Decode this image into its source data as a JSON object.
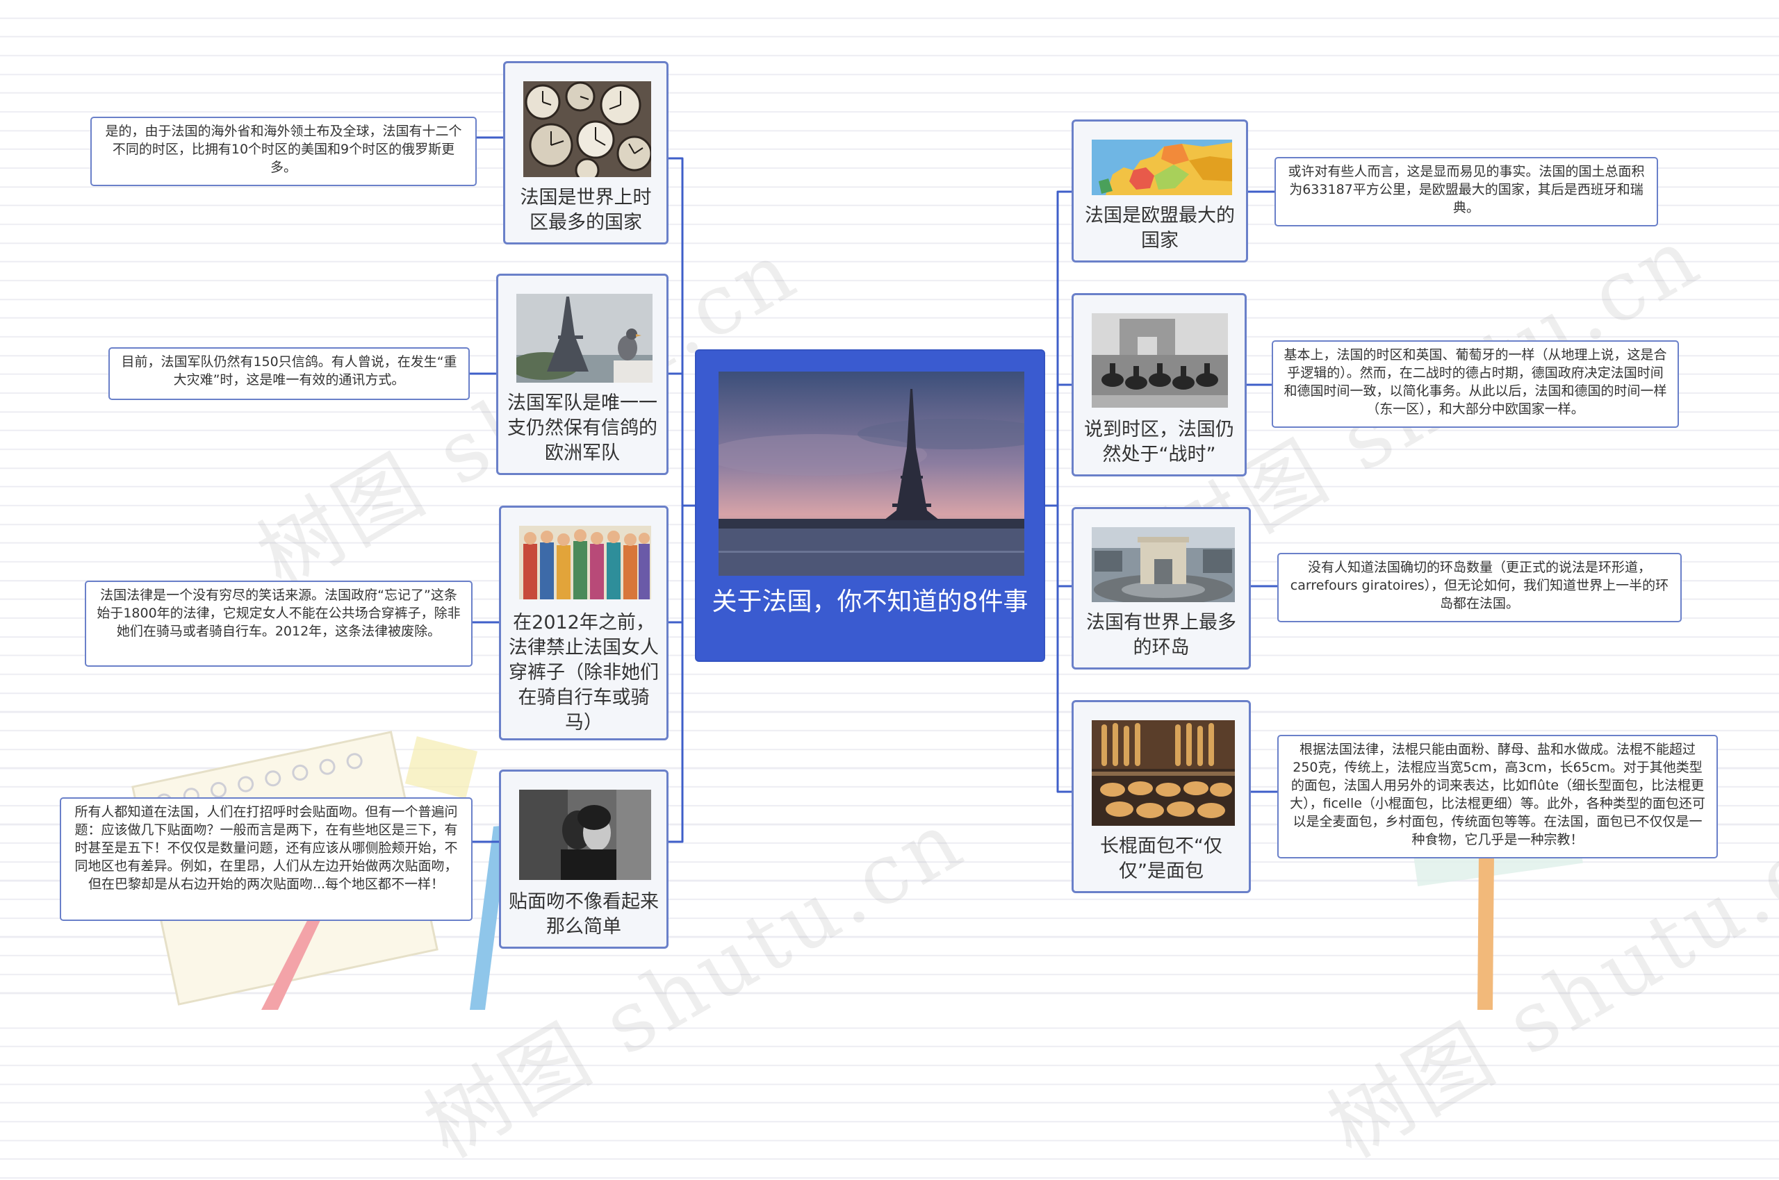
{
  "center": {
    "title": "关于法国，你不知道的8件事"
  },
  "watermark": "树图 shutu.cn",
  "colors": {
    "accent": "#3a5bd0",
    "line": "#3f5fc9",
    "border": "#6a80c9"
  },
  "topics": {
    "timezones": {
      "label": "法国是世界上时区最多的国家",
      "note": "是的，由于法国的海外省和海外领土布及全球，法国有十二个不同的时区，比拥有10个时区的美国和9个时区的俄罗斯更多。"
    },
    "pigeons": {
      "label": "法国军队是唯一一支仍然保有信鸽的欧洲军队",
      "note": "目前，法国军队仍然有150只信鸽。有人曾说，在发生“重大灾难”时，这是唯一有效的通讯方式。"
    },
    "trousers": {
      "label": "在2012年之前，法律禁止法国女人穿裤子（除非她们在骑自行车或骑马）",
      "note": "法国法律是一个没有穷尽的笑话来源。法国政府“忘记了”这条始于1800年的法律，它规定女人不能在公共场合穿裤子，除非她们在骑马或者骑自行车。2012年，这条法律被废除。"
    },
    "kiss": {
      "label": "贴面吻不像看起来那么简单",
      "note": "所有人都知道在法国，人们在打招呼时会贴面吻。但有一个普遍问题：应该做几下贴面吻？一般而言是两下，在有些地区是三下，有时甚至是五下！不仅仅是数量问题，还有应该从哪侧脸颊开始，不同地区也有差异。例如，在里昂，人们从左边开始做两次贴面吻，但在巴黎却是从右边开始的两次贴面吻...每个地区都不一样！"
    },
    "largest": {
      "label": "法国是欧盟最大的国家",
      "note": "或许对有些人而言，这是显而易见的事实。法国的国土总面积为633187平方公里，是欧盟最大的国家，其后是西班牙和瑞典。"
    },
    "war": {
      "label": "说到时区，法国仍然处于“战时”",
      "note": "基本上，法国的时区和英国、葡萄牙的一样（从地理上说，这是合乎逻辑的）。然而，在二战时的德占时期，德国政府决定法国时间和德国时间一致，以简化事务。从此以后，法国和德国的时间一样（东一区），和大部分中欧国家一样。"
    },
    "roundabouts": {
      "label": "法国有世界上最多的环岛",
      "note": "没有人知道法国确切的环岛数量（更正式的说法是环形道，carrefours giratoires），但无论如何，我们知道世界上一半的环岛都在法国。"
    },
    "baguette": {
      "label": "长棍面包不“仅仅”是面包",
      "note": "根据法国法律，法棍只能由面粉、酵母、盐和水做成。法棍不能超过250克，传统上，法棍应当宽5cm，高3cm，长65cm。对于其他类型的面包，法国人用另外的词来表达，比如flûte（细长型面包，比法棍更大），ficelle（小棍面包，比法棍更细）等。此外，各种类型的面包还可以是全麦面包，乡村面包，传统面包等等。在法国，面包已不仅仅是一种食物，它几乎是一种宗教！"
    }
  }
}
